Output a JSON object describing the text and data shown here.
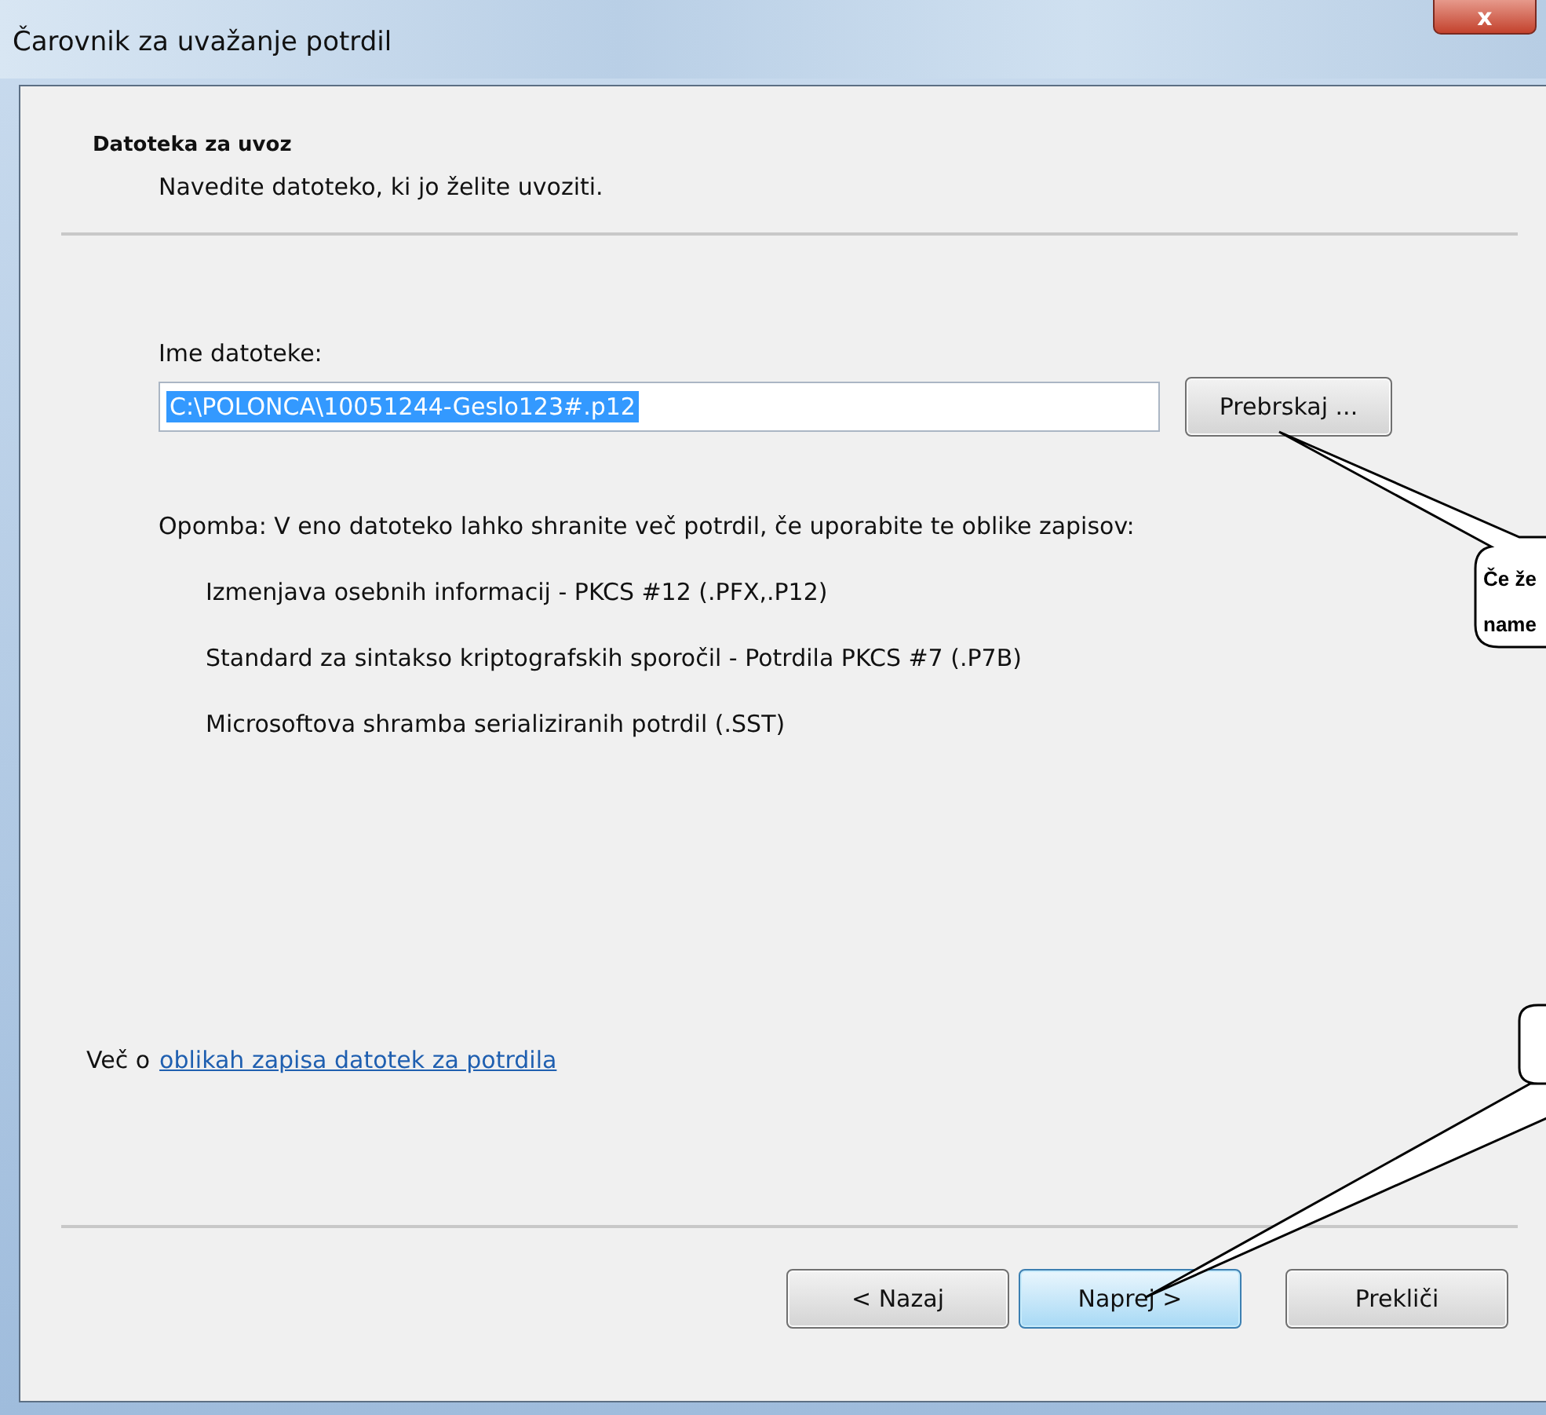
{
  "window": {
    "title": "Čarovnik za uvažanje potrdil",
    "close_button": "x"
  },
  "header": {
    "title": "Datoteka za uvoz",
    "subtitle": "Navedite datoteko, ki jo želite uvoziti."
  },
  "file_field": {
    "label": "Ime datoteke:",
    "value": "C:\\POLONCA\\10051244-Geslo123#.p12",
    "text_selected": true,
    "browse_button": "Prebrskaj ..."
  },
  "note": "Opomba: V eno datoteko lahko shranite več potrdil, če uporabite te oblike zapisov:",
  "formats": [
    "Izmenjava osebnih informacij - PKCS #12 (.PFX,.P12)",
    "Standard za sintakso kriptografskih sporočil - Potrdila PKCS #7 (.P7B)",
    "Microsoftova shramba serializiranih potrdil (.SST)"
  ],
  "more_info": {
    "prefix": "Več o",
    "link": "oblikah zapisa datotek za potrdila"
  },
  "buttons": [
    {
      "label": "< Nazaj",
      "default": false
    },
    {
      "label": "Naprej >",
      "default": true
    },
    {
      "label": "Prekliči",
      "default": false
    }
  ],
  "callouts": [
    {
      "kind": "text",
      "lines": [
        "Če že",
        "name"
      ]
    },
    {
      "kind": "empty"
    }
  ]
}
